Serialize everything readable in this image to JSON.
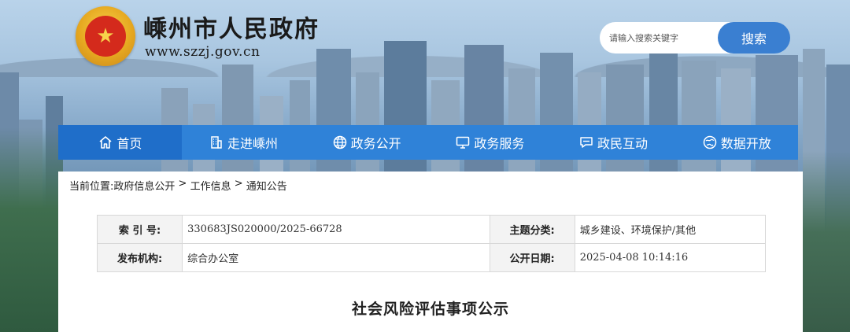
{
  "header": {
    "site_title": "嵊州市人民政府",
    "site_url": "www.szzj.gov.cn",
    "emblem_icon": "national-emblem-icon"
  },
  "search": {
    "placeholder": "请输入搜索关键字",
    "button_label": "搜索"
  },
  "nav": {
    "items": [
      {
        "label": "首页",
        "icon": "home-icon"
      },
      {
        "label": "走进嵊州",
        "icon": "building-icon"
      },
      {
        "label": "政务公开",
        "icon": "globe-icon"
      },
      {
        "label": "政务服务",
        "icon": "monitor-icon"
      },
      {
        "label": "政民互动",
        "icon": "chat-icon"
      },
      {
        "label": "数据开放",
        "icon": "database-globe-icon"
      }
    ],
    "active_index": 0
  },
  "breadcrumb": {
    "prefix": "当前位置:",
    "items": [
      "政府信息公开",
      "工作信息",
      "通知公告"
    ],
    "separator": " > "
  },
  "info": {
    "index_label": "索 引 号:",
    "index_value": "330683JS020000/2025-66728",
    "topic_label": "主题分类:",
    "topic_value": "城乡建设、环境保护/其他",
    "org_label": "发布机构:",
    "org_value": "综合办公室",
    "date_label": "公开日期:",
    "date_value": "2025-04-08 10:14:16"
  },
  "document": {
    "title": "社会风险评估事项公示"
  },
  "colors": {
    "nav_bg": "#2f82d8",
    "nav_active": "#1f6ec9",
    "search_button": "#3a7fd1"
  }
}
